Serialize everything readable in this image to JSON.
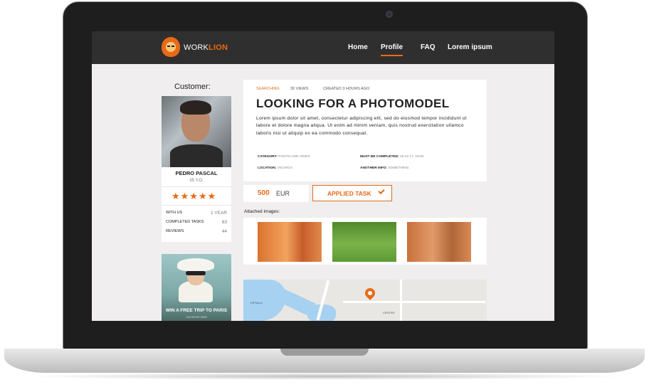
{
  "nav": {
    "logo_prefix": "WORK",
    "logo_accent": "LION",
    "items": [
      "Home",
      "Profile",
      "FAQ",
      "Lorem ipsum"
    ],
    "active": "Profile"
  },
  "customer": {
    "heading": "Customer:",
    "name": "PEDRO PASCAL",
    "age": "35 Y.O.",
    "stars": "★★★★★",
    "stats": [
      {
        "label": "WITH US",
        "value": "1 YEAR"
      },
      {
        "label": "COMPLETED TASKS",
        "value": "63"
      },
      {
        "label": "REVIEWS",
        "value": "44"
      }
    ]
  },
  "ad": {
    "title": "WIN A FREE TRIP TO PARIS",
    "subtitle": "OLD MOVIE WINS"
  },
  "task": {
    "status": "SEARCHING",
    "views": "30 VIEWS",
    "created": "CREATED 3 HOURS AGO",
    "title": "LOOKING FOR A PHOTOMODEL",
    "description": "Lorem ipsum dolor sit amet, consectetur adipiscing elit, sed do eiusmod tempor incididunt ut labore et dolore magna aliqua. Ut enim ad minim veniam, quis nostrud exercitation ullamco laboris nisi ut aliquip ex ea commodo consequat.",
    "details": {
      "category_label": "CATEGORY:",
      "category_value": "PHOTO AND VIDEO",
      "location_label": "LOCATION:",
      "location_value": "VECRIGA",
      "deadline_label": "MUST BE COMPLETED:",
      "deadline_value": "15.12.17, 15:00",
      "info_label": "ANOTHER INFO:",
      "info_value": "SOMETHING"
    }
  },
  "price": {
    "amount": "500",
    "currency": "EUR"
  },
  "applied_label": "APPLIED TASK",
  "attached_label": "Attached images:",
  "map": {
    "label_west": "KIPSALA",
    "label_centre": "CENTRS"
  },
  "colors": {
    "accent": "#e86a16",
    "nav_bg": "#2f2f2f",
    "page_bg": "#f0eeef"
  }
}
